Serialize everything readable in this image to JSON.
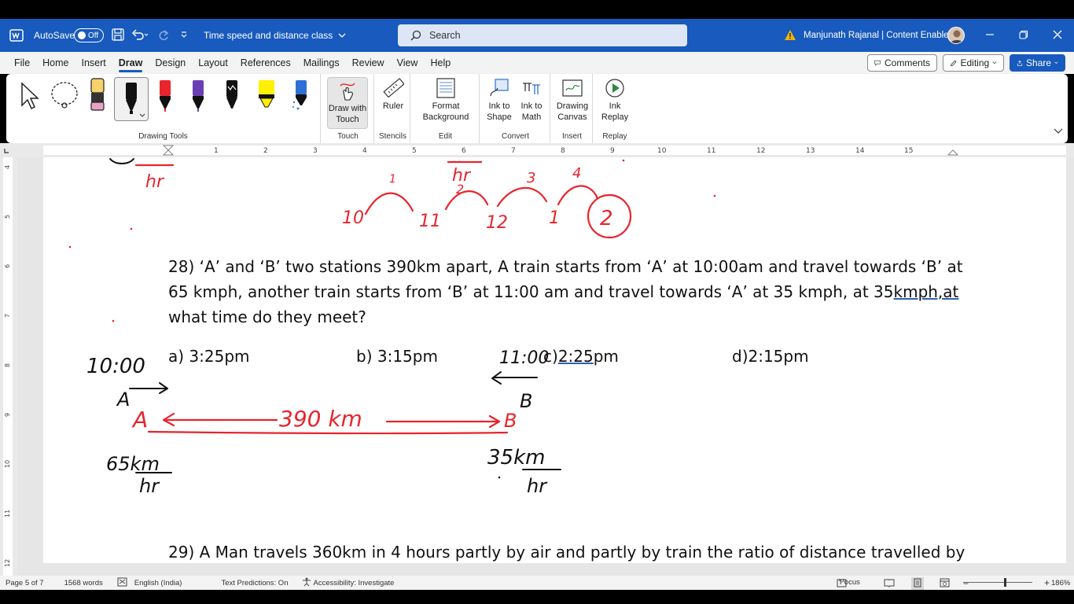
{
  "title_bar": {
    "autosave_label": "AutoSave",
    "autosave_state": "Off",
    "doc_title": "Time speed and distance class",
    "search_placeholder": "Search",
    "user_name": "Manjunath Rajanal | Content Enablers"
  },
  "menu": {
    "tabs": [
      "File",
      "Home",
      "Insert",
      "Draw",
      "Design",
      "Layout",
      "References",
      "Mailings",
      "Review",
      "View",
      "Help"
    ],
    "active_tab": "Draw",
    "comments_label": "Comments",
    "editing_label": "Editing",
    "share_label": "Share"
  },
  "ribbon": {
    "draw_with_touch": "Draw with Touch",
    "ruler": "Ruler",
    "format_background": "Format Background",
    "ink_to_shape": "Ink to Shape",
    "ink_to_math": "Ink to Math",
    "drawing_canvas": "Drawing Canvas",
    "ink_replay": "Ink Replay",
    "groups": {
      "drawing_tools": "Drawing Tools",
      "touch": "Touch",
      "stencils": "Stencils",
      "edit": "Edit",
      "convert": "Convert",
      "insert": "Insert",
      "replay": "Replay"
    }
  },
  "document": {
    "q28_line1": "28) ‘A’ and ‘B’ two stations 390km apart, A train starts from ‘A’ at 10:00am and travel towards ‘B’ at",
    "q28_line2_a": "65 kmph, another train starts from ‘B’ at 11:00 am and travel towards ‘A’ at 35 kmph, at 35",
    "q28_line2_b": "kmph,at",
    "q28_line3": "what time do they meet?",
    "opt_a": "a) 3:25pm",
    "opt_b": "b) 3:15pm",
    "opt_c_a": "c)",
    "opt_c_b": "2:25",
    "opt_c_c": "pm",
    "opt_d": "d)2:15pm",
    "q29_line1": "29) A Man travels 360km in 4 hours partly by air and partly by train the ratio of distance travelled by"
  },
  "ink": {
    "top_hr": "hr",
    "top_hr2": "hr",
    "hours": [
      "10",
      "11",
      "12",
      "1"
    ],
    "arc_labels": [
      "1",
      "2",
      "3",
      "4"
    ],
    "circled": "2",
    "time_a": "10:00",
    "time_b": "11:00",
    "label_a": "A",
    "label_b": "B",
    "red_a": "A",
    "red_b": "B",
    "distance": "390 km",
    "speed_a_num": "65km",
    "speed_a_den": "hr",
    "speed_b_num": "35km",
    "speed_b_den": "hr",
    "color_red": "#e8242c",
    "color_black": "#111111"
  },
  "status": {
    "page": "Page 5 of 7",
    "words": "1568 words",
    "language": "English (India)",
    "text_predictions": "Text Predictions: On",
    "accessibility": "Accessibility: Investigate",
    "focus": "Focus",
    "zoom": "186%"
  }
}
